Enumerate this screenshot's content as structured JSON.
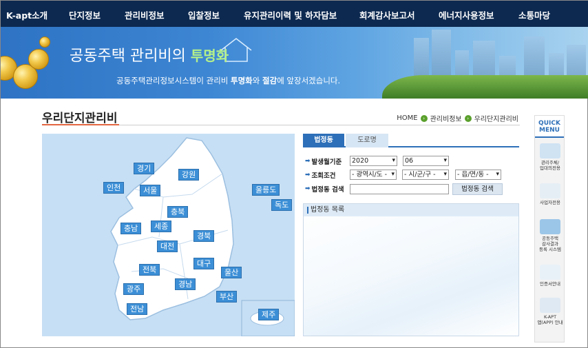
{
  "nav": {
    "items": [
      "K-apt소개",
      "단지정보",
      "관리비정보",
      "입찰정보",
      "유지관리이력 및 하자담보",
      "회계감사보고서",
      "에너지사용정보",
      "소통마당"
    ]
  },
  "banner": {
    "title_main": "공동주택 관리비의 ",
    "title_highlight": "투명화",
    "sub_pre": "공동주택관리정보시스템이 관리비 ",
    "sub_b1": "투명화",
    "sub_mid": "와 ",
    "sub_b2": "절감",
    "sub_post": "에 앞장서겠습니다."
  },
  "page": {
    "title": "우리단지관리비",
    "breadcrumb": [
      "HOME",
      "관리비정보",
      "우리단지관리비"
    ]
  },
  "map": {
    "regions": [
      "경기",
      "강원",
      "인천",
      "서울",
      "충북",
      "충남",
      "세종",
      "경북",
      "대전",
      "전북",
      "대구",
      "울산",
      "경남",
      "광주",
      "부산",
      "전남",
      "제주",
      "울릉도",
      "독도"
    ]
  },
  "search": {
    "tabs": [
      "법정동",
      "도로명"
    ],
    "label_period": "발생월기준",
    "year": "2020",
    "month": "06",
    "label_cond": "조회조건",
    "sido": "- 광역시/도 -",
    "sigungu": "- 시/군/구 -",
    "eupmyeondong": "- 읍/면/동 -",
    "label_dong": "법정동 검색",
    "dong_value": "",
    "search_button": "법정동 검색",
    "list_header": "법정동 목록"
  },
  "quick": {
    "title_1": "QUICK",
    "title_2": "MENU",
    "items": [
      {
        "line1": "관리주체/",
        "line2": "입대의전용",
        "line3": "",
        "icon": "monitor-chart-icon",
        "color": "#cfe3f3"
      },
      {
        "line1": "사업자전용",
        "line2": "",
        "line3": "",
        "icon": "handshake-icon",
        "color": "#e5eef5"
      },
      {
        "line1": "공동주택",
        "line2": "감사결과",
        "line3": "등록 시스템",
        "icon": "monitor-city-icon",
        "color": "#9cc6e8"
      },
      {
        "line1": "인증서안내",
        "line2": "",
        "line3": "",
        "icon": "certificate-icon",
        "color": "#e9f1f8"
      },
      {
        "line1": "K-APT",
        "line2": "앱(APP) 안내",
        "line3": "",
        "icon": "smartphone-icon",
        "color": "#dfe9f3"
      }
    ]
  }
}
